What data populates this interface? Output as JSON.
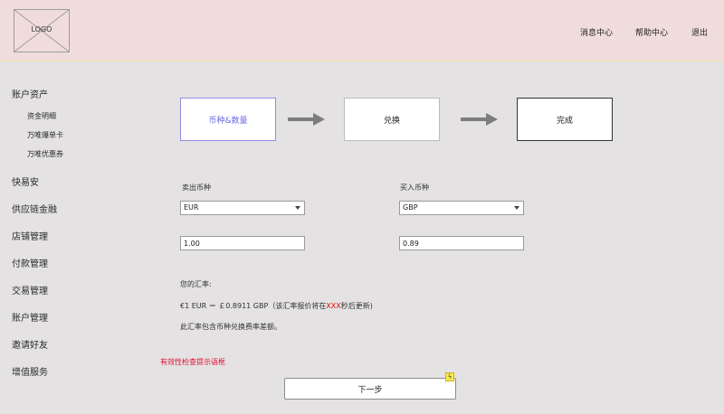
{
  "header": {
    "logo_text": "LOGO",
    "nav": {
      "messages": "消息中心",
      "help": "帮助中心",
      "logout": "退出"
    }
  },
  "sidebar": {
    "account_assets": "账户资产",
    "sub_items": [
      "资金明细",
      "万唯爆单卡",
      "万唯优惠券"
    ],
    "items": [
      "快易安",
      "供应链金融",
      "店铺管理",
      "付款管理",
      "交易管理",
      "账户管理",
      "邀请好友",
      "增值服务"
    ]
  },
  "steps": {
    "step1": "币种&数量",
    "step2": "兑换",
    "step3": "完成"
  },
  "form": {
    "sell_label": "卖出币种",
    "buy_label": "买入币种",
    "sell_currency": "EUR",
    "buy_currency": "GBP",
    "sell_amount": "1.00",
    "buy_amount": "0.89"
  },
  "rate": {
    "title": "您的汇率:",
    "line_prefix": "€1 EUR ＝ ￡0.8911 GBP（该汇率报价将在",
    "highlight": "XXX",
    "line_suffix": "秒后更新)",
    "note": "此汇率包含币种兑换费率差额。"
  },
  "validation_hint": "有效性检查提示语框",
  "next_button": "下一步",
  "badge_icon": "lightning-icon",
  "colors": {
    "header_bg": "#f1dcdc",
    "page_bg": "#e4e2e2",
    "active_step": "#6a6ae4",
    "error": "#e0103a"
  }
}
